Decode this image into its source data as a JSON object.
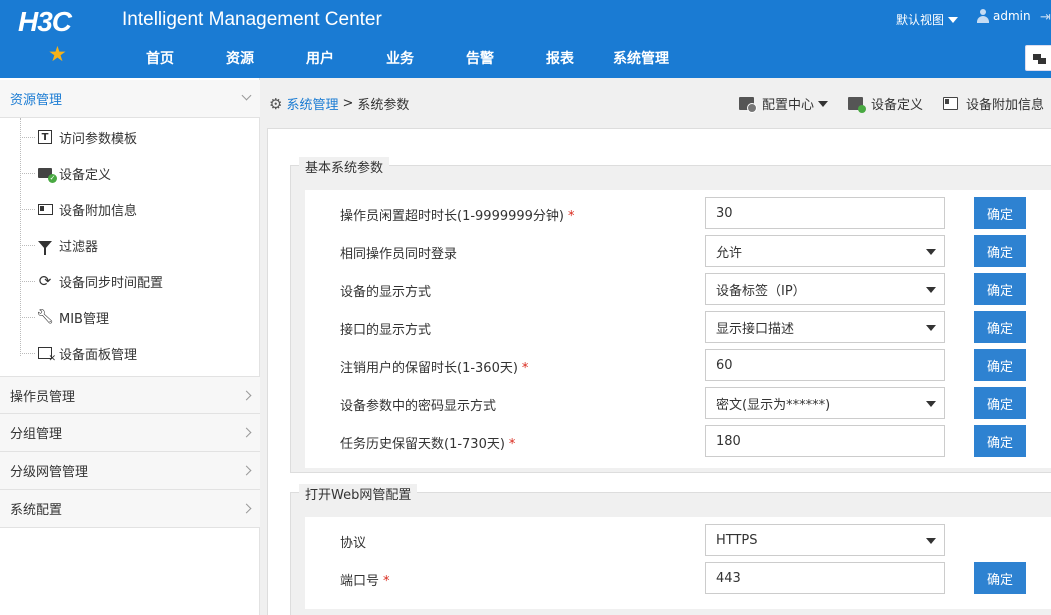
{
  "header": {
    "logo": "H3C",
    "app_title": "Intelligent Management Center",
    "view_select": "默认视图",
    "user": "admin"
  },
  "nav": [
    "首页",
    "资源",
    "用户",
    "业务",
    "告警",
    "报表",
    "系统管理"
  ],
  "sidebar": {
    "active_section": "资源管理",
    "items": [
      "访问参数模板",
      "设备定义",
      "设备附加信息",
      "过滤器",
      "设备同步时间配置",
      "MIB管理",
      "设备面板管理"
    ],
    "sections": [
      "操作员管理",
      "分组管理",
      "分级网管管理",
      "系统配置"
    ]
  },
  "breadcrumb": {
    "parent": "系统管理",
    "separator": ">",
    "current": "系统参数"
  },
  "toolbar": {
    "config_center": "配置中心",
    "device_def": "设备定义",
    "device_extra": "设备附加信息"
  },
  "basic": {
    "legend": "基本系统参数",
    "rows": [
      {
        "label": "操作员闲置超时时长(1-9999999分钟)",
        "required": "*",
        "value": "30",
        "type": "input"
      },
      {
        "label": "相同操作员同时登录",
        "required": "",
        "value": "允许",
        "type": "select"
      },
      {
        "label": "设备的显示方式",
        "required": "",
        "value": "设备标签（IP）",
        "type": "select"
      },
      {
        "label": "接口的显示方式",
        "required": "",
        "value": "显示接口描述",
        "type": "select"
      },
      {
        "label": "注销用户的保留时长(1-360天)",
        "required": "*",
        "value": "60",
        "type": "input"
      },
      {
        "label": "设备参数中的密码显示方式",
        "required": "",
        "value": "密文(显示为******)",
        "type": "select"
      },
      {
        "label": "任务历史保留天数(1-730天)",
        "required": "*",
        "value": "180",
        "type": "input"
      }
    ]
  },
  "web": {
    "legend": "打开Web网管配置",
    "rows": [
      {
        "label": "协议",
        "required": "",
        "value": "HTTPS",
        "type": "select"
      },
      {
        "label": "端口号",
        "required": "*",
        "value": "443",
        "type": "input"
      }
    ]
  },
  "ok_label": "确定"
}
